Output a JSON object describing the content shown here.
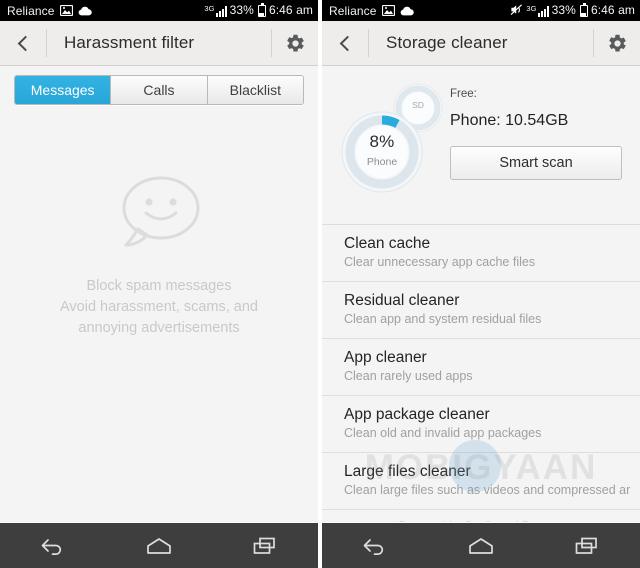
{
  "colors": {
    "accent_blue": "#29abde",
    "statusbar_bg": "#000000",
    "actionbar_bg": "#eeedeb",
    "page_bg": "#f4f4f4",
    "navbar_bg": "#3e3e3e",
    "muted_text": "#a0a0a0"
  },
  "left_phone": {
    "statusbar": {
      "carrier": "Reliance",
      "network": "3G",
      "battery_percent": "33%",
      "time": "6:46 am",
      "icons": [
        "image-icon",
        "cloud-icon",
        "signal-bars-icon",
        "battery-icon"
      ]
    },
    "actionbar": {
      "title": "Harassment filter",
      "back_icon": "back-chevron-icon",
      "settings_icon": "gear-icon"
    },
    "tabs": [
      {
        "label": "Messages",
        "active": true
      },
      {
        "label": "Calls",
        "active": false
      },
      {
        "label": "Blacklist",
        "active": false
      }
    ],
    "empty_state": {
      "icon": "smiley-speech-bubble-icon",
      "line1": "Block spam messages",
      "line2": "Avoid harassment, scams, and",
      "line3": "annoying advertisements"
    }
  },
  "right_phone": {
    "statusbar": {
      "carrier": "Reliance",
      "network": "3G",
      "battery_percent": "33%",
      "time": "6:46 am",
      "icons": [
        "image-icon",
        "cloud-icon",
        "mute-icon",
        "signal-bars-icon",
        "battery-icon"
      ]
    },
    "actionbar": {
      "title": "Storage cleaner",
      "back_icon": "back-chevron-icon",
      "settings_icon": "gear-icon"
    },
    "storage": {
      "phone_percent_label": "8%",
      "phone_percent_value": 8,
      "phone_dial_name": "Phone",
      "sd_dial_name": "SD",
      "free_label": "Free:",
      "free_phone": "Phone: 10.54GB",
      "smart_scan_label": "Smart scan"
    },
    "cleaners": [
      {
        "title": "Clean cache",
        "subtitle": "Clear unnecessary app cache files"
      },
      {
        "title": "Residual cleaner",
        "subtitle": "Clean app and system residual files"
      },
      {
        "title": "App cleaner",
        "subtitle": "Clean rarely used apps"
      },
      {
        "title": "App package cleaner",
        "subtitle": "Clean old and invalid app packages"
      },
      {
        "title": "Large files cleaner",
        "subtitle": "Clean large files such as videos and compressed ar"
      }
    ],
    "powered_by": "Powered by Du Speed Booster",
    "watermark": "MOBIGYAAN"
  },
  "navbar": {
    "back": "back-arrow-icon",
    "home": "home-icon",
    "recents": "recents-icon"
  }
}
